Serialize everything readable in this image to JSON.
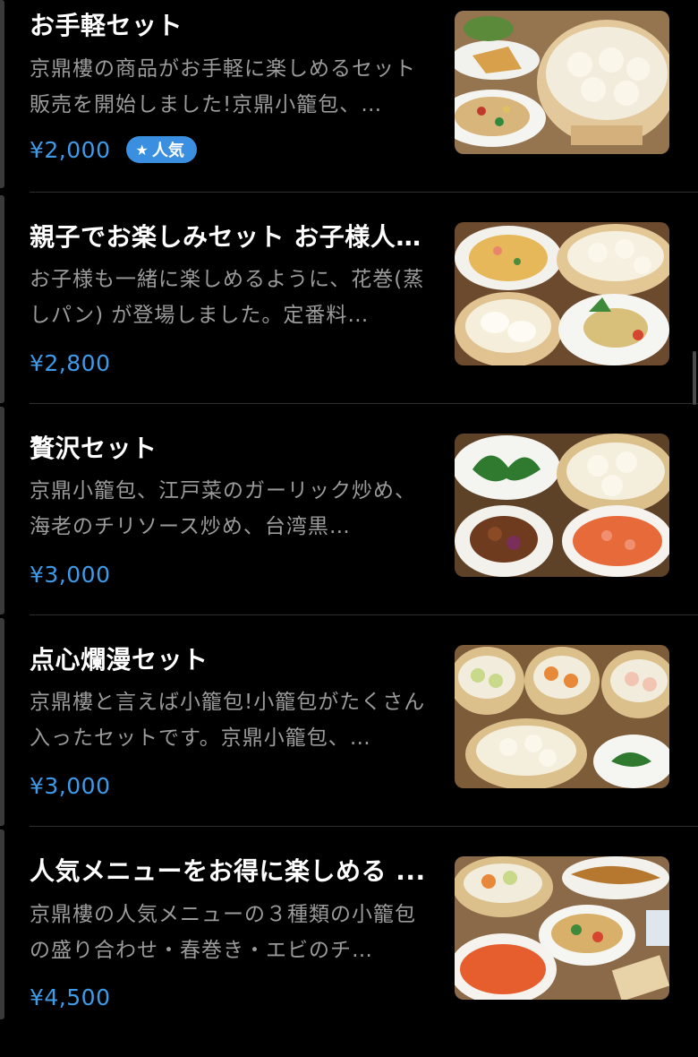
{
  "items": [
    {
      "title": "お手軽セット",
      "description": "京鼎樓の商品がお手軽に楽しめるセット販売を開始しました!京鼎小籠包、…",
      "price": "¥2,000",
      "badge": {
        "icon": "star-icon",
        "label": "人気"
      },
      "image": "food-photo"
    },
    {
      "title": "親子でお楽しみセット お子様人…",
      "description": "お子様も一緒に楽しめるように、花巻(蒸しパン) が登場しました。定番料…",
      "price": "¥2,800",
      "image": "food-photo"
    },
    {
      "title": "贅沢セット",
      "description": "京鼎小籠包、江戸菜のガーリック炒め、海老のチリソース炒め、台湾黒…",
      "price": "¥3,000",
      "image": "food-photo"
    },
    {
      "title": "点心爛漫セット",
      "description": "京鼎樓と言えば小籠包!小籠包がたくさん入ったセットです。京鼎小籠包、…",
      "price": "¥3,000",
      "image": "food-photo"
    },
    {
      "title": "人気メニューをお得に楽しめる ...",
      "description": "京鼎樓の人気メニューの３種類の小籠包の盛り合わせ・春巻き・エビのチ…",
      "price": "¥4,500",
      "image": "food-photo"
    }
  ],
  "colors": {
    "background": "#000000",
    "price": "#3d9be9",
    "badge": "#3a8fe0",
    "description": "#9b9b9b",
    "divider": "#2e2e2e"
  }
}
